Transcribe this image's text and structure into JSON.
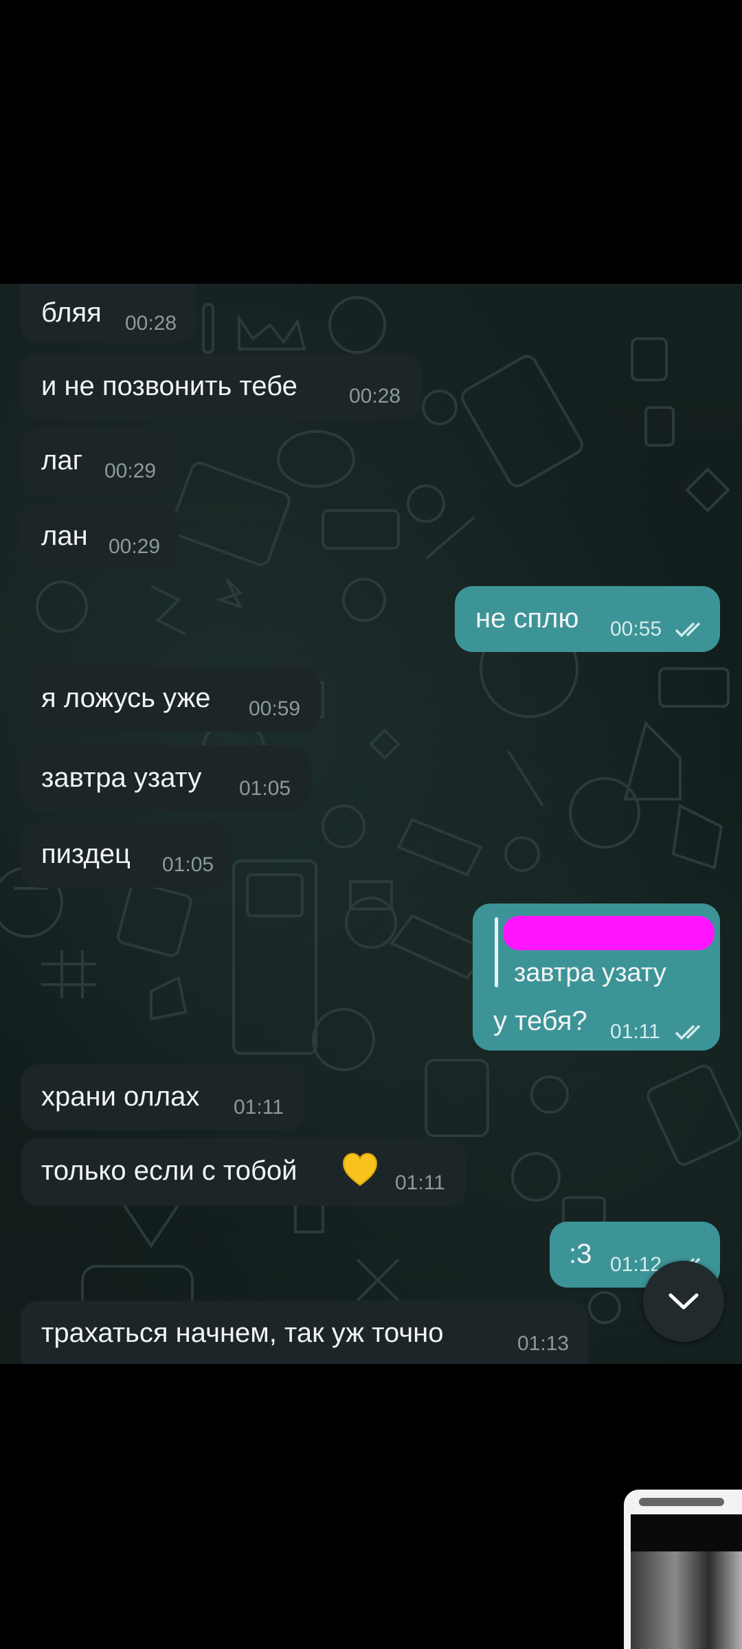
{
  "messages": [
    {
      "dir": "in",
      "text": "бляя",
      "time": "00:28"
    },
    {
      "dir": "in",
      "text": "и не позвонить тебе",
      "time": "00:28"
    },
    {
      "dir": "in",
      "text": "лаг",
      "time": "00:29"
    },
    {
      "dir": "in",
      "text": "лан",
      "time": "00:29"
    },
    {
      "dir": "out",
      "text": "не сплю",
      "time": "00:55",
      "status": "read"
    },
    {
      "dir": "in",
      "text": "я ложусь уже",
      "time": "00:59"
    },
    {
      "dir": "in",
      "text": "завтра узату",
      "time": "01:05"
    },
    {
      "dir": "in",
      "text": "пиздец",
      "time": "01:05"
    },
    {
      "dir": "out",
      "reply_text": "завтра узату",
      "text": "у тебя?",
      "time": "01:11",
      "status": "read"
    },
    {
      "dir": "in",
      "text": "храни оллах",
      "time": "01:11"
    },
    {
      "dir": "in",
      "text": "только если с тобой",
      "emoji": "yellow-heart",
      "time": "01:11"
    },
    {
      "dir": "out",
      "text": ":3",
      "time": "01:12",
      "status": "read"
    },
    {
      "dir": "in",
      "text": "трахаться начнем, так уж точно",
      "time": "01:13"
    }
  ],
  "scroll_button_icon": "chevron-down-icon",
  "colors": {
    "incoming": "#1c2527",
    "outgoing": "#3d9497",
    "background": "#121d1c",
    "redaction": "#ff16ff"
  }
}
